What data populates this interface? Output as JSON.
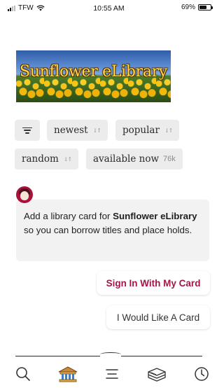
{
  "status_bar": {
    "carrier": "TFW",
    "time": "10:55 AM",
    "battery": "69%",
    "battery_level": 0.69
  },
  "banner": {
    "title": "Sunflower eLibrary"
  },
  "filters": {
    "menu_icon": "hamburger-menu-icon",
    "sort_icon": "sort-arrows-icon",
    "chips": [
      {
        "label": "newest"
      },
      {
        "label": "popular"
      },
      {
        "label": "random"
      },
      {
        "label": "available now",
        "count": "76k"
      }
    ]
  },
  "message": {
    "avatar_icon": "librarian-avatar-icon",
    "text_prefix": "Add a library card for ",
    "library_name": "Sunflower eLibrary",
    "text_suffix": " so you can borrow titles and place holds."
  },
  "actions": {
    "sign_in": "Sign In With My Card",
    "want_card": "I Would Like A Card"
  },
  "tabbar": {
    "items": [
      {
        "icon": "search-icon"
      },
      {
        "icon": "library-icon",
        "active": true
      },
      {
        "icon": "menu-icon"
      },
      {
        "icon": "shelf-icon"
      },
      {
        "icon": "clock-icon"
      }
    ]
  },
  "colors": {
    "accent": "#a0174a",
    "chip_bg": "#ececec",
    "bubble_bg": "#f2f2f2"
  }
}
